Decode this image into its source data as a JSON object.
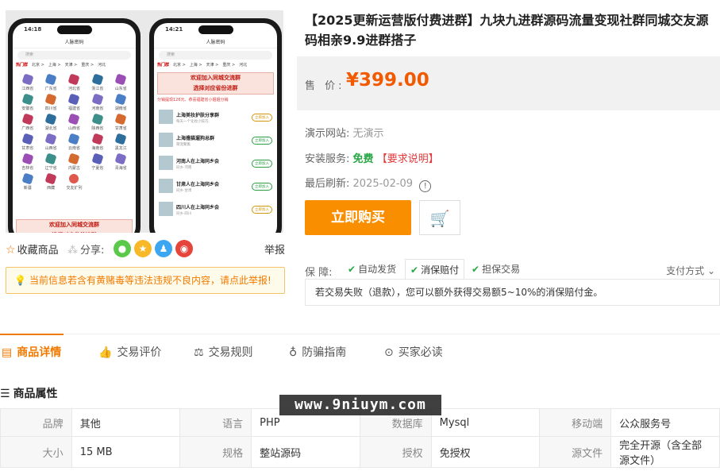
{
  "gallery": {
    "phone1": {
      "time": "14:18",
      "title": "人脉密码",
      "search": "搜索",
      "tabs": [
        "热门群",
        "北京 >",
        "上海 >",
        "天津 >",
        "重庆 >",
        "河北"
      ],
      "provinces": [
        "江西省",
        "广东省",
        "河北省",
        "浙江省",
        "山东省",
        "安徽省",
        "四川省",
        "福建省",
        "河南省",
        "湖南省",
        "广西省",
        "湖北省",
        "山西省",
        "陕西省",
        "甘肃省",
        "甘肃省",
        "山西省",
        "云南省",
        "海南省",
        "黑龙江",
        "吉林省",
        "辽宁省",
        "内蒙古",
        "宁夏省",
        "青海省",
        "新疆",
        "西藏",
        "交友扩列"
      ],
      "banner": "欢迎加入同城交流群\n选择对应省份进群"
    },
    "phone2": {
      "time": "14:21",
      "title": "人脉密码",
      "search": "搜索",
      "tabs": [
        "热门群",
        "北京 >",
        "上海 >",
        "天津 >",
        "重庆 >",
        "河北"
      ],
      "banner": "欢迎加入同城交流群\n选择对应省份进群",
      "line": "分销提现126元、恭喜福建省小姐姐分销",
      "items": [
        {
          "name": "上海美妆护肤分享群",
          "sub": "每天一个化妆小技巧",
          "btn": "立即加入"
        },
        {
          "name": "上海撸猫遛狗总群",
          "sub": "萌宠聚集",
          "btn": "立即加入"
        },
        {
          "name": "河南人在上海同乡会",
          "sub": "同乡·河南",
          "btn": "立即加入"
        },
        {
          "name": "甘肃人在上海同乡会",
          "sub": "同乡·甘肃",
          "btn": "立即加入"
        },
        {
          "name": "四川人在上海同乡会",
          "sub": "同乡·四川",
          "btn": "立即加入"
        }
      ]
    }
  },
  "share_row": {
    "favorite": "收藏商品",
    "share_label": "分享:",
    "report": "举报"
  },
  "notice": "当前信息若含有黄赌毒等违法违规不良内容，请点此举报!",
  "product": {
    "title": "【2025更新运营版付费进群】九块九进群源码流量变现社群同城交友源码相亲9.9进群搭子",
    "price_label": "售 价:",
    "price": "¥399.00",
    "demo_label": "演示网站:",
    "demo_value": "无演示",
    "install_label": "安装服务:",
    "install_value": "免费",
    "install_req": "【要求说明】",
    "refresh_label": "最后刷新:",
    "refresh_value": "2025-02-09",
    "buy_label": "立即购买"
  },
  "guarantee": {
    "label": "保 障:",
    "tabs": [
      "自动发货",
      "消保赔付",
      "担保交易"
    ],
    "pay": "支付方式",
    "desc": "若交易失败（退款），您可以额外获得交易额5~10%的消保赔付金。"
  },
  "tabs": [
    "商品详情",
    "交易评价",
    "交易规则",
    "防骗指南",
    "买家必读"
  ],
  "attributes": {
    "title": "商品属性",
    "rows": [
      [
        [
          "品牌",
          "其他"
        ],
        [
          "语言",
          "PHP"
        ],
        [
          "数据库",
          "Mysql"
        ],
        [
          "移动端",
          "公众服务号"
        ]
      ],
      [
        [
          "大小",
          "15 MB"
        ],
        [
          "规格",
          "整站源码"
        ],
        [
          "授权",
          "免授权"
        ],
        [
          "源文件",
          "完全开源（含全部源文件）"
        ]
      ]
    ]
  },
  "watermark": "www.9niuym.com",
  "colors": {
    "accent": "#f98f00",
    "price": "#f15a00",
    "free": "#28a745",
    "warn": "#e4393c"
  }
}
